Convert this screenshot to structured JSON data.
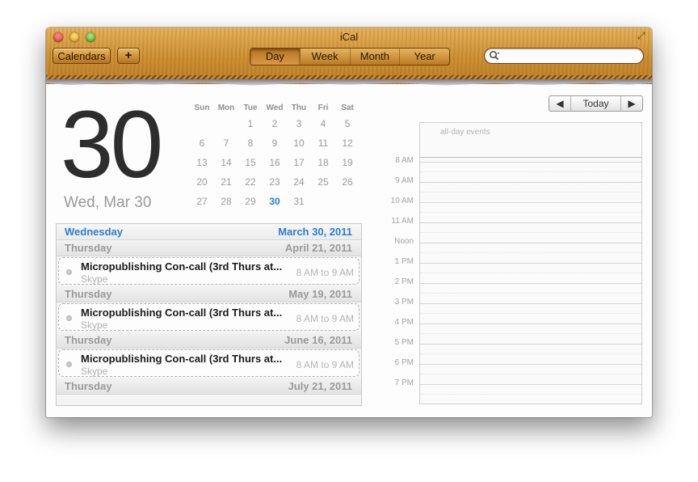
{
  "window": {
    "title": "iCal"
  },
  "toolbar": {
    "calendars_label": "Calendars",
    "add_label": "+",
    "views": [
      {
        "label": "Day",
        "active": true
      },
      {
        "label": "Week",
        "active": false
      },
      {
        "label": "Month",
        "active": false
      },
      {
        "label": "Year",
        "active": false
      }
    ],
    "search": {
      "placeholder": "",
      "value": ""
    }
  },
  "selected_date": {
    "day_number": "30",
    "label": "Wed, Mar 30"
  },
  "mini_calendar": {
    "weekdays": [
      "Sun",
      "Mon",
      "Tue",
      "Wed",
      "Thu",
      "Fri",
      "Sat"
    ],
    "weeks": [
      [
        "",
        "",
        "1",
        "2",
        "3",
        "4",
        "5"
      ],
      [
        "6",
        "7",
        "8",
        "9",
        "10",
        "11",
        "12"
      ],
      [
        "13",
        "14",
        "15",
        "16",
        "17",
        "18",
        "19"
      ],
      [
        "20",
        "21",
        "22",
        "23",
        "24",
        "25",
        "26"
      ],
      [
        "27",
        "28",
        "29",
        "30",
        "31",
        "",
        ""
      ]
    ],
    "today": "30"
  },
  "event_list": {
    "current_day": {
      "weekday": "Wednesday",
      "date": "March 30, 2011"
    },
    "groups": [
      {
        "weekday": "Thursday",
        "date": "April 21, 2011",
        "event": {
          "title": "Micropublishing Con-call (3rd Thurs at...",
          "subtitle": "Skype",
          "time": "8 AM to 9 AM"
        }
      },
      {
        "weekday": "Thursday",
        "date": "May 19, 2011",
        "event": {
          "title": "Micropublishing Con-call (3rd Thurs at...",
          "subtitle": "Skype",
          "time": "8 AM to 9 AM"
        }
      },
      {
        "weekday": "Thursday",
        "date": "June 16, 2011",
        "event": {
          "title": "Micropublishing Con-call (3rd Thurs at...",
          "subtitle": "Skype",
          "time": "8 AM to 9 AM"
        }
      }
    ],
    "last_header": {
      "weekday": "Thursday",
      "date": "July 21, 2011"
    }
  },
  "day_view": {
    "nav": {
      "prev": "◀",
      "today_label": "Today",
      "next": "▶"
    },
    "allday_label": "all-day events",
    "hours": [
      "8 AM",
      "9 AM",
      "10 AM",
      "11 AM",
      "Noon",
      "1 PM",
      "2 PM",
      "3 PM",
      "4 PM",
      "5 PM",
      "6 PM",
      "7 PM"
    ]
  }
}
